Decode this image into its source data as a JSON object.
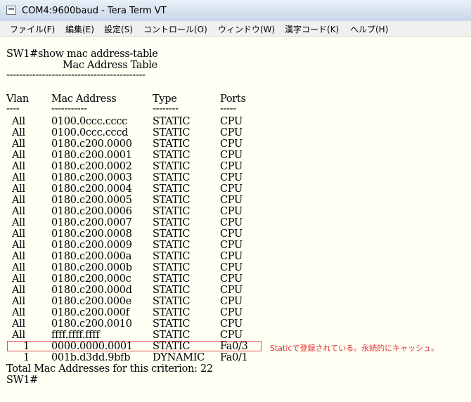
{
  "window": {
    "title": "COM4:9600baud - Tera Term VT",
    "icon": "teraterm-app-icon"
  },
  "menu": [
    {
      "label": "ファイル(F)"
    },
    {
      "label": "編集(E)"
    },
    {
      "label": "設定(S)"
    },
    {
      "label": "コントロール(O)"
    },
    {
      "label": "ウィンドウ(W)"
    },
    {
      "label": "漢字コード(K)"
    },
    {
      "label": "ヘルプ(H)"
    }
  ],
  "terminal": {
    "command_line": "SW1#show mac address-table",
    "table_title": "Mac Address Table",
    "separator": "-------------------------------------------",
    "headers": {
      "vlan": "Vlan",
      "mac": "Mac Address",
      "type": "Type",
      "ports": "Ports"
    },
    "header_underlines": {
      "vlan": "----",
      "mac": "-----------",
      "type": "--------",
      "ports": "-----"
    },
    "rows": [
      {
        "vlan": "All",
        "mac": "0100.0ccc.cccc",
        "type": "STATIC",
        "ports": "CPU"
      },
      {
        "vlan": "All",
        "mac": "0100.0ccc.cccd",
        "type": "STATIC",
        "ports": "CPU"
      },
      {
        "vlan": "All",
        "mac": "0180.c200.0000",
        "type": "STATIC",
        "ports": "CPU"
      },
      {
        "vlan": "All",
        "mac": "0180.c200.0001",
        "type": "STATIC",
        "ports": "CPU"
      },
      {
        "vlan": "All",
        "mac": "0180.c200.0002",
        "type": "STATIC",
        "ports": "CPU"
      },
      {
        "vlan": "All",
        "mac": "0180.c200.0003",
        "type": "STATIC",
        "ports": "CPU"
      },
      {
        "vlan": "All",
        "mac": "0180.c200.0004",
        "type": "STATIC",
        "ports": "CPU"
      },
      {
        "vlan": "All",
        "mac": "0180.c200.0005",
        "type": "STATIC",
        "ports": "CPU"
      },
      {
        "vlan": "All",
        "mac": "0180.c200.0006",
        "type": "STATIC",
        "ports": "CPU"
      },
      {
        "vlan": "All",
        "mac": "0180.c200.0007",
        "type": "STATIC",
        "ports": "CPU"
      },
      {
        "vlan": "All",
        "mac": "0180.c200.0008",
        "type": "STATIC",
        "ports": "CPU"
      },
      {
        "vlan": "All",
        "mac": "0180.c200.0009",
        "type": "STATIC",
        "ports": "CPU"
      },
      {
        "vlan": "All",
        "mac": "0180.c200.000a",
        "type": "STATIC",
        "ports": "CPU"
      },
      {
        "vlan": "All",
        "mac": "0180.c200.000b",
        "type": "STATIC",
        "ports": "CPU"
      },
      {
        "vlan": "All",
        "mac": "0180.c200.000c",
        "type": "STATIC",
        "ports": "CPU"
      },
      {
        "vlan": "All",
        "mac": "0180.c200.000d",
        "type": "STATIC",
        "ports": "CPU"
      },
      {
        "vlan": "All",
        "mac": "0180.c200.000e",
        "type": "STATIC",
        "ports": "CPU"
      },
      {
        "vlan": "All",
        "mac": "0180.c200.000f",
        "type": "STATIC",
        "ports": "CPU"
      },
      {
        "vlan": "All",
        "mac": "0180.c200.0010",
        "type": "STATIC",
        "ports": "CPU"
      },
      {
        "vlan": "All",
        "mac": "ffff.ffff.ffff",
        "type": "STATIC",
        "ports": "CPU"
      },
      {
        "vlan": "1",
        "mac": "0000.0000.0001",
        "type": "STATIC",
        "ports": "Fa0/3"
      },
      {
        "vlan": "1",
        "mac": "001b.d3dd.9bfb",
        "type": "DYNAMIC",
        "ports": "Fa0/1"
      }
    ],
    "total_line": "Total Mac Addresses for this criterion: 22",
    "prompt": "SW1#"
  },
  "annotation": {
    "text": "Staticで登録されている。永続的にキャッシュ。",
    "color": "#e03030"
  }
}
